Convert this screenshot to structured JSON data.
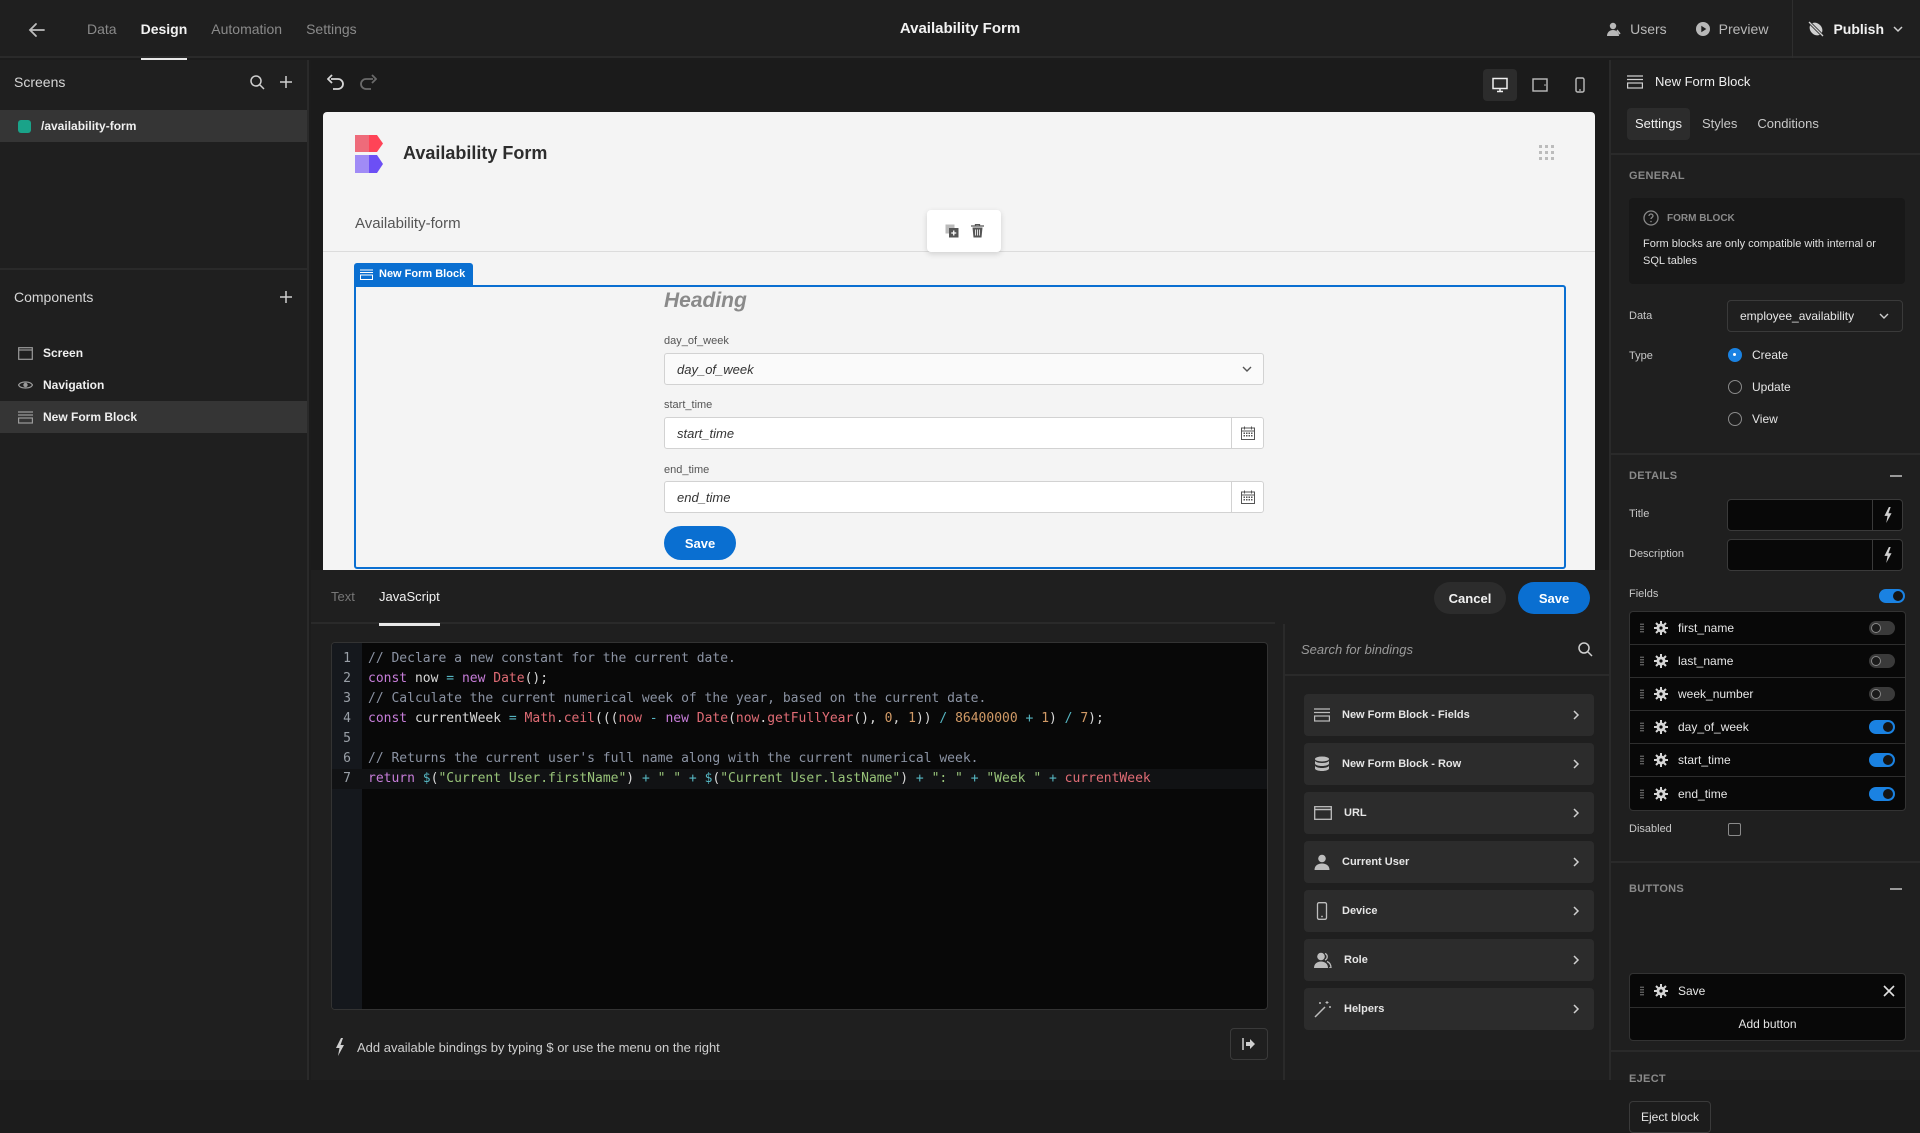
{
  "app": {
    "title": "Availability Form",
    "nav_tabs": [
      {
        "label": "Data",
        "active": false
      },
      {
        "label": "Design",
        "active": true
      },
      {
        "label": "Automation",
        "active": false
      },
      {
        "label": "Settings",
        "active": false
      }
    ],
    "top_actions": {
      "users": "Users",
      "preview": "Preview",
      "publish": "Publish"
    }
  },
  "left_panel": {
    "screens_title": "Screens",
    "screens": [
      {
        "path": "/availability-form",
        "color": "#1aa389",
        "selected": true
      }
    ],
    "components_title": "Components",
    "components": [
      {
        "label": "Screen",
        "icon": "screen-icon",
        "selected": false
      },
      {
        "label": "Navigation",
        "icon": "eye-icon",
        "selected": false
      },
      {
        "label": "New Form Block",
        "icon": "form-block-icon",
        "selected": true
      }
    ]
  },
  "canvas": {
    "device_modes": [
      "desktop",
      "tablet",
      "mobile"
    ],
    "active_device": "desktop",
    "preview_title": "Availability Form",
    "page_label": "Availability-form",
    "block_tag": "New Form Block",
    "form": {
      "heading": "Heading",
      "fields": [
        {
          "label": "day_of_week",
          "placeholder": "day_of_week",
          "type": "select"
        },
        {
          "label": "start_time",
          "placeholder": "start_time",
          "type": "datetime"
        },
        {
          "label": "end_time",
          "placeholder": "end_time",
          "type": "datetime"
        }
      ],
      "save_label": "Save"
    }
  },
  "binding_editor": {
    "tabs": [
      {
        "label": "Text",
        "active": false
      },
      {
        "label": "JavaScript",
        "active": true
      }
    ],
    "cancel_label": "Cancel",
    "save_label": "Save",
    "code_lines": [
      "// Declare a new constant for the current date.",
      "const now = new Date();",
      "// Calculate the current numerical week of the year, based on the current date.",
      "const currentWeek = Math.ceil(((now - new Date(now.getFullYear(), 0, 1)) / 86400000 + 1) / 7);",
      "",
      "// Returns the current user's full name along with the current numerical week.",
      "return $(\"Current User.firstName\") + \" \" + $(\"Current User.lastName\") + \": \" + \"Week \" + currentWeek"
    ],
    "active_line": 7,
    "hint": "Add available bindings by typing $ or use the menu on the right",
    "search_placeholder": "Search for bindings",
    "binding_categories": [
      {
        "label": "New Form Block - Fields",
        "icon": "form-block-icon"
      },
      {
        "label": "New Form Block - Row",
        "icon": "database-icon"
      },
      {
        "label": "URL",
        "icon": "browser-window-icon"
      },
      {
        "label": "Current User",
        "icon": "user-icon"
      },
      {
        "label": "Device",
        "icon": "mobile-device-icon"
      },
      {
        "label": "Role",
        "icon": "users-icon"
      },
      {
        "label": "Helpers",
        "icon": "magic-wand-icon"
      }
    ]
  },
  "right_panel": {
    "title": "New Form Block",
    "tabs": [
      {
        "label": "Settings",
        "active": true
      },
      {
        "label": "Styles",
        "active": false
      },
      {
        "label": "Conditions",
        "active": false
      }
    ],
    "general": {
      "section_title": "GENERAL",
      "info_title": "FORM BLOCK",
      "info_text": "Form blocks are only compatible with internal or SQL tables",
      "data_label": "Data",
      "data_value": "employee_availability",
      "type_label": "Type",
      "type_options": [
        {
          "label": "Create",
          "selected": true
        },
        {
          "label": "Update",
          "selected": false
        },
        {
          "label": "View",
          "selected": false
        }
      ]
    },
    "details": {
      "section_title": "DETAILS",
      "title_label": "Title",
      "title_value": "",
      "description_label": "Description",
      "description_value": "",
      "fields_label": "Fields",
      "fields_enabled": true,
      "fields": [
        {
          "name": "first_name",
          "enabled": false
        },
        {
          "name": "last_name",
          "enabled": false
        },
        {
          "name": "week_number",
          "enabled": false
        },
        {
          "name": "day_of_week",
          "enabled": true
        },
        {
          "name": "start_time",
          "enabled": true
        },
        {
          "name": "end_time",
          "enabled": true
        }
      ],
      "disabled_label": "Disabled",
      "disabled_checked": false
    },
    "buttons": {
      "section_title": "BUTTONS",
      "items": [
        {
          "label": "Save"
        }
      ],
      "add_label": "Add button"
    },
    "eject": {
      "section_title": "EJECT",
      "button_label": "Eject block"
    }
  },
  "colors": {
    "accent": "#0a6fd1",
    "toggle_on": "#1a82e2",
    "screen_badge": "#1aa389",
    "background": "#1f1f1f"
  }
}
